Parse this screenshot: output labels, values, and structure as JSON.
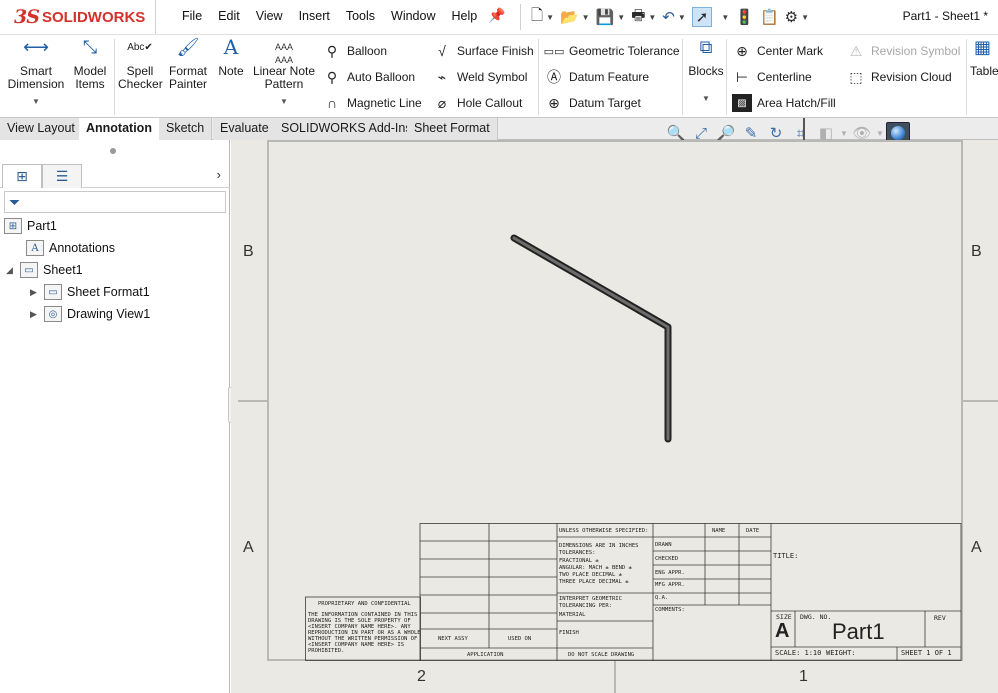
{
  "app": {
    "brand_ds": "3S",
    "brand_name": "SOLIDWORKS",
    "document_title": "Part1 - Sheet1 *"
  },
  "menu": [
    "File",
    "Edit",
    "View",
    "Insert",
    "Tools",
    "Window",
    "Help"
  ],
  "ribbon": {
    "smart_dimension": "Smart Dimension",
    "model_items": "Model Items",
    "spell_checker": "Spell Checker",
    "format_painter": "Format Painter",
    "note": "Note",
    "linear_note_pattern": "Linear Note Pattern",
    "balloon": "Balloon",
    "auto_balloon": "Auto Balloon",
    "magnetic_line": "Magnetic Line",
    "surface_finish": "Surface Finish",
    "weld_symbol": "Weld Symbol",
    "hole_callout": "Hole Callout",
    "geometric_tolerance": "Geometric Tolerance",
    "datum_feature": "Datum Feature",
    "datum_target": "Datum Target",
    "blocks": "Blocks",
    "center_mark": "Center Mark",
    "centerline": "Centerline",
    "area_hatch": "Area Hatch/Fill",
    "revision_symbol": "Revision Symbol",
    "revision_cloud": "Revision Cloud",
    "table": "Table"
  },
  "tabs": [
    "View Layout",
    "Annotation",
    "Sketch",
    "Evaluate",
    "SOLIDWORKS Add-Ins",
    "Sheet Format"
  ],
  "active_tab": "Annotation",
  "tree": {
    "root": "Part1",
    "annotations": "Annotations",
    "sheet": "Sheet1",
    "sheet_format": "Sheet Format1",
    "drawing_view": "Drawing View1"
  },
  "zones": {
    "left_b": "B",
    "right_b": "B",
    "left_a": "A",
    "right_a": "A",
    "bottom_2": "2",
    "bottom_1": "1"
  },
  "title_block": {
    "unless_otherwise": "UNLESS OTHERWISE SPECIFIED:",
    "name": "NAME",
    "date": "DATE",
    "drawn": "DRAWN",
    "checked": "CHECKED",
    "eng_appr": "ENG APPR.",
    "mfg_appr": "MFG APPR.",
    "qa": "Q.A.",
    "comments": "COMMENTS:",
    "dims": "DIMENSIONS ARE IN INCHES",
    "tolerances": "TOLERANCES:",
    "fractional": "FRACTIONAL ±",
    "angular": "ANGULAR: MACH ±   BEND ±",
    "two_place": "TWO PLACE DECIMAL   ±",
    "three_place": "THREE PLACE DECIMAL  ±",
    "interpret": "INTERPRET GEOMETRIC",
    "tolerancing": "TOLERANCING PER:",
    "material": "MATERIAL",
    "finish": "FINISH",
    "next_assy": "NEXT ASSY",
    "used_on": "USED ON",
    "application": "APPLICATION",
    "do_not_scale": "DO NOT SCALE DRAWING",
    "proprietary": "PROPRIETARY AND CONFIDENTIAL",
    "prop_l1": "THE INFORMATION CONTAINED IN THIS",
    "prop_l2": "DRAWING IS THE SOLE PROPERTY OF",
    "prop_l3": "<INSERT COMPANY NAME HERE>. ANY",
    "prop_l4": "REPRODUCTION IN PART OR AS A WHOLE",
    "prop_l5": "WITHOUT THE WRITTEN PERMISSION OF",
    "prop_l6": "<INSERT COMPANY NAME HERE> IS",
    "prop_l7": "PROHIBITED.",
    "title": "TITLE:",
    "size_label": "SIZE",
    "size": "A",
    "dwg_no_label": "DWG. NO.",
    "dwg_no": "Part1",
    "rev": "REV",
    "scale": "SCALE: 1:10",
    "weight": "WEIGHT:",
    "sheet": "SHEET 1 OF 1"
  }
}
